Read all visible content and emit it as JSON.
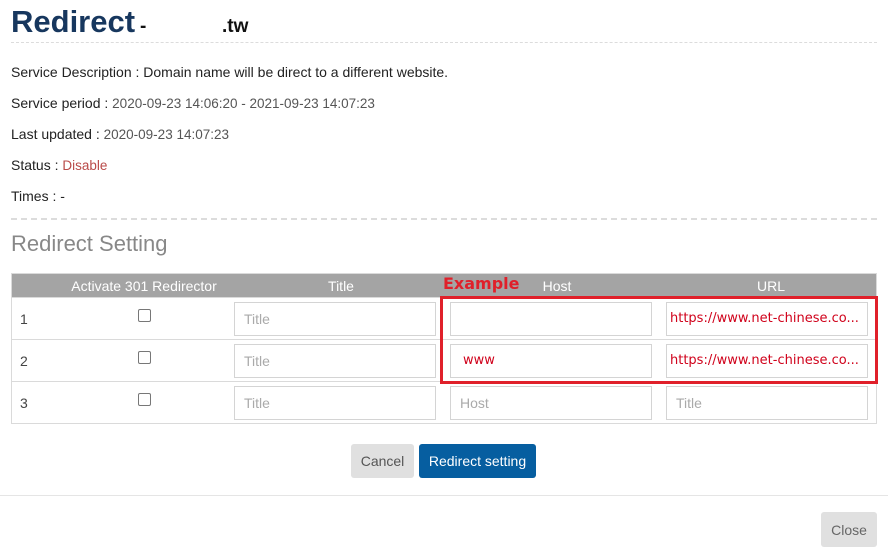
{
  "header": {
    "title": "Redirect",
    "dash": "-",
    "domain_suffix": ".tw"
  },
  "info": {
    "description_label": "Service Description : ",
    "description_value": "Domain name will be direct to a different website.",
    "period_label": "Service period : ",
    "period_value": "2020-09-23 14:06:20 - 2021-09-23 14:07:23",
    "updated_label": "Last updated : ",
    "updated_value": "2020-09-23 14:07:23",
    "status_label": "Status : ",
    "status_value": "Disable",
    "times_label": "Times : ",
    "times_value": "-"
  },
  "section_title": "Redirect Setting",
  "table": {
    "headers": [
      "",
      "Activate 301 Redirector",
      "Title",
      "Host",
      "URL"
    ],
    "rows": [
      {
        "no": "1",
        "checked": false,
        "title_value": "",
        "title_placeholder": "Title",
        "host_value": "",
        "host_placeholder": "",
        "url_value": "https://www.net-chinese.co...",
        "url_placeholder": ""
      },
      {
        "no": "2",
        "checked": false,
        "title_value": "",
        "title_placeholder": "Title",
        "host_value": "www",
        "host_placeholder": "",
        "url_value": "https://www.net-chinese.co...",
        "url_placeholder": ""
      },
      {
        "no": "3",
        "checked": false,
        "title_value": "",
        "title_placeholder": "Title",
        "host_value": "",
        "host_placeholder": "Host",
        "url_value": "",
        "url_placeholder": "Title"
      }
    ]
  },
  "annotation": {
    "label": "Example",
    "color": "#e0202a"
  },
  "buttons": {
    "cancel": "Cancel",
    "redirect": "Redirect setting",
    "close": "Close"
  },
  "colors": {
    "title": "#17375e",
    "primary_button": "#065ea0",
    "status_disabled": "#b94a48",
    "table_header": "#a4a4a4"
  }
}
